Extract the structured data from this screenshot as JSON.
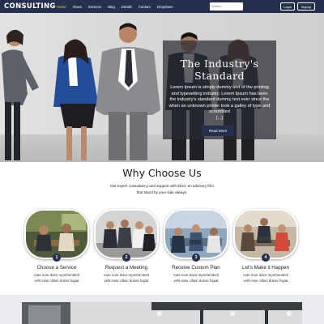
{
  "navbar": {
    "brand": "CONSULTING",
    "links": [
      "Home",
      "About",
      "Services",
      "Blog",
      "Details",
      "Contact",
      "Dropdown"
    ],
    "search_placeholder": "Search",
    "login_label": "Login",
    "signup_label": "Signup"
  },
  "hero": {
    "title_line1": "The Industry's",
    "title_line2": "Standard",
    "body": "Lorem Ipsum is simply dummy text of the printing and typesetting industry. Lorem Ipsum has been the industry's standard dummy text ever since the when an unknown printer took a galley of type and scrambled",
    "ellipsis": "[...]",
    "button_label": "Read More"
  },
  "why": {
    "title": "Why Choose Us",
    "subtitle_line1": "Get expert consultancy and support with Elixir, an advisory firm",
    "subtitle_line2": "that stand by your side always."
  },
  "steps": [
    {
      "number": "1",
      "title": "Choose a Service",
      "desc_line1": "Aute irure dolor reprehenderit",
      "desc_line2": "velit esse cillum dolore fugiat"
    },
    {
      "number": "2",
      "title": "Request a Meeting",
      "desc_line1": "Aute irure dolor reprehenderit",
      "desc_line2": "velit esse cillum dolore fugiat"
    },
    {
      "number": "3",
      "title": "Receive Custom Plan",
      "desc_line1": "Aute irure dolor reprehenderit",
      "desc_line2": "velit esse cillum dolore fugiat"
    },
    {
      "number": "4",
      "title": "Let's Make it Happen",
      "desc_line1": "Aute irure dolor reprehenderit",
      "desc_line2": "velit esse cillum dolore fugiat"
    }
  ],
  "colors": {
    "navbar": "#262f4e",
    "active_link": "#ffd24a",
    "overlay": "#282a32",
    "step_badge": "#262f4e"
  }
}
